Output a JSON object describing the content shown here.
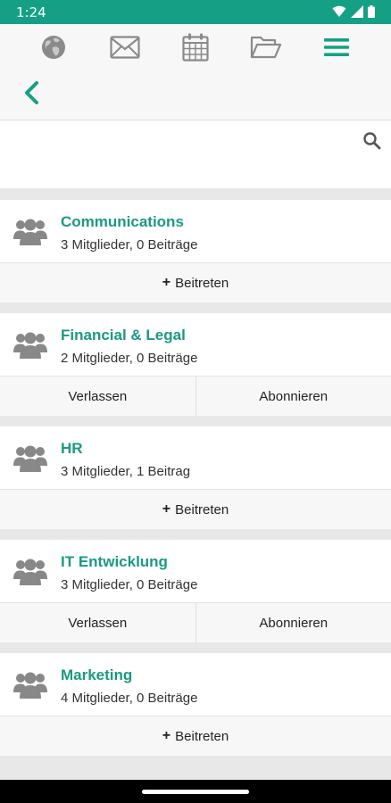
{
  "status_bar": {
    "time": "1:24",
    "icons": [
      "wifi-icon",
      "cell-signal-icon",
      "battery-icon"
    ]
  },
  "top_nav": {
    "items": [
      {
        "icon": "globe-icon"
      },
      {
        "icon": "mail-icon"
      },
      {
        "icon": "calendar-icon"
      },
      {
        "icon": "folder-icon"
      },
      {
        "icon": "menu-icon",
        "active": true
      }
    ]
  },
  "back": {
    "icon": "chevron-left-icon"
  },
  "search": {
    "value": "",
    "placeholder": "",
    "icon": "search-icon"
  },
  "groups": [
    {
      "name": "Communications",
      "meta": "3 Mitglieder, 0 Beiträge",
      "actions": [
        {
          "label": "Beitreten",
          "plus": true
        }
      ]
    },
    {
      "name": "Financial & Legal",
      "meta": "2 Mitglieder, 0 Beiträge",
      "actions": [
        {
          "label": "Verlassen"
        },
        {
          "label": "Abonnieren"
        }
      ]
    },
    {
      "name": "HR",
      "meta": "3 Mitglieder, 1 Beitrag",
      "actions": [
        {
          "label": "Beitreten",
          "plus": true
        }
      ]
    },
    {
      "name": "IT Entwicklung",
      "meta": "3 Mitglieder, 0 Beiträge",
      "actions": [
        {
          "label": "Verlassen"
        },
        {
          "label": "Abonnieren"
        }
      ]
    },
    {
      "name": "Marketing",
      "meta": "4 Mitglieder, 0 Beiträge",
      "actions": [
        {
          "label": "Beitreten",
          "plus": true
        }
      ]
    }
  ],
  "colors": {
    "accent": "#15a085",
    "name_text": "#1a9a80",
    "icon_gray": "#8a8a8a",
    "avatar_gray": "#888888"
  }
}
